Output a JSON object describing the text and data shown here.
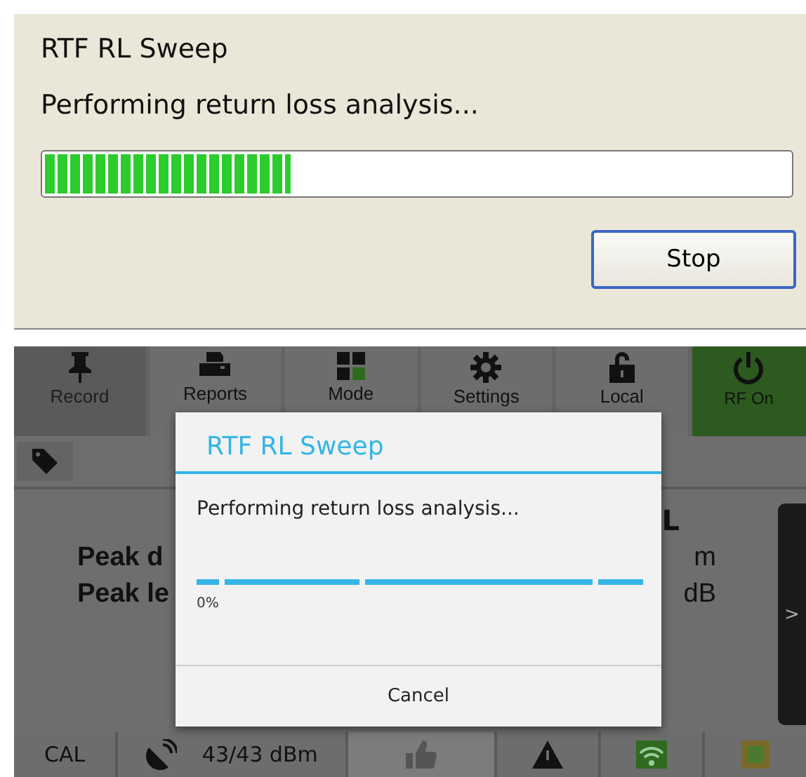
{
  "desktop_dialog": {
    "title": "RTF RL Sweep",
    "message": "Performing return loss analysis...",
    "progress": {
      "level": 0.33
    },
    "button": "Stop"
  },
  "android_screen": {
    "toolbar": [
      {
        "kind": "pin",
        "label": "Record",
        "disabled": true
      },
      {
        "kind": "printer",
        "label": "Reports",
        "disabled": false
      },
      {
        "kind": "grid",
        "label": "Mode",
        "disabled": false
      },
      {
        "kind": "gear",
        "label": "Settings",
        "disabled": false
      },
      {
        "kind": "lock",
        "label": "Local",
        "disabled": false
      },
      {
        "kind": "power",
        "label": "RF On",
        "disabled": false
      }
    ],
    "content": {
      "header": "L",
      "rows": [
        {
          "label": "Peak d",
          "value": "m"
        },
        {
          "label": "Peak le",
          "value": "dB"
        }
      ],
      "side_button": ">"
    },
    "status_bar": {
      "cal": "CAL",
      "power": "43/43 dBm"
    },
    "dialog": {
      "title": "RTF RL Sweep",
      "message": "Performing return loss analysis...",
      "indeterminate": true,
      "percent": "0%",
      "button": "Cancel"
    }
  }
}
